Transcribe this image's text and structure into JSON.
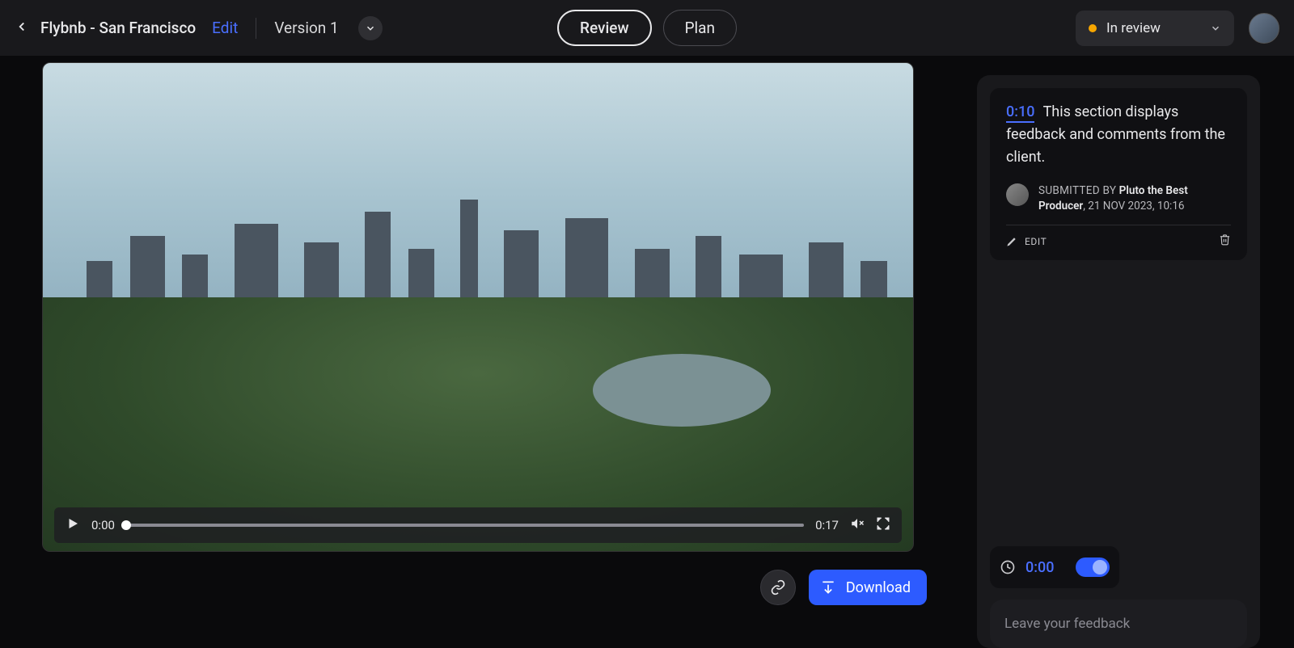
{
  "header": {
    "title": "Flybnb - San Francisco",
    "edit_label": "Edit",
    "version_label": "Version 1",
    "tabs": {
      "review": "Review",
      "plan": "Plan"
    },
    "status_label": "In review"
  },
  "video": {
    "current_time": "0:00",
    "duration": "0:17"
  },
  "actions": {
    "download_label": "Download"
  },
  "comment": {
    "timestamp": "0:10",
    "body": "This section displays feedback and comments from the client.",
    "submitted_label": "SUBMITTED BY",
    "author": "Pluto the Best Producer",
    "meta": ", 21 NOV 2023, 10:16",
    "edit_label": "EDIT"
  },
  "timebox": {
    "value": "0:00"
  },
  "feedback_input": {
    "placeholder": "Leave your feedback"
  }
}
